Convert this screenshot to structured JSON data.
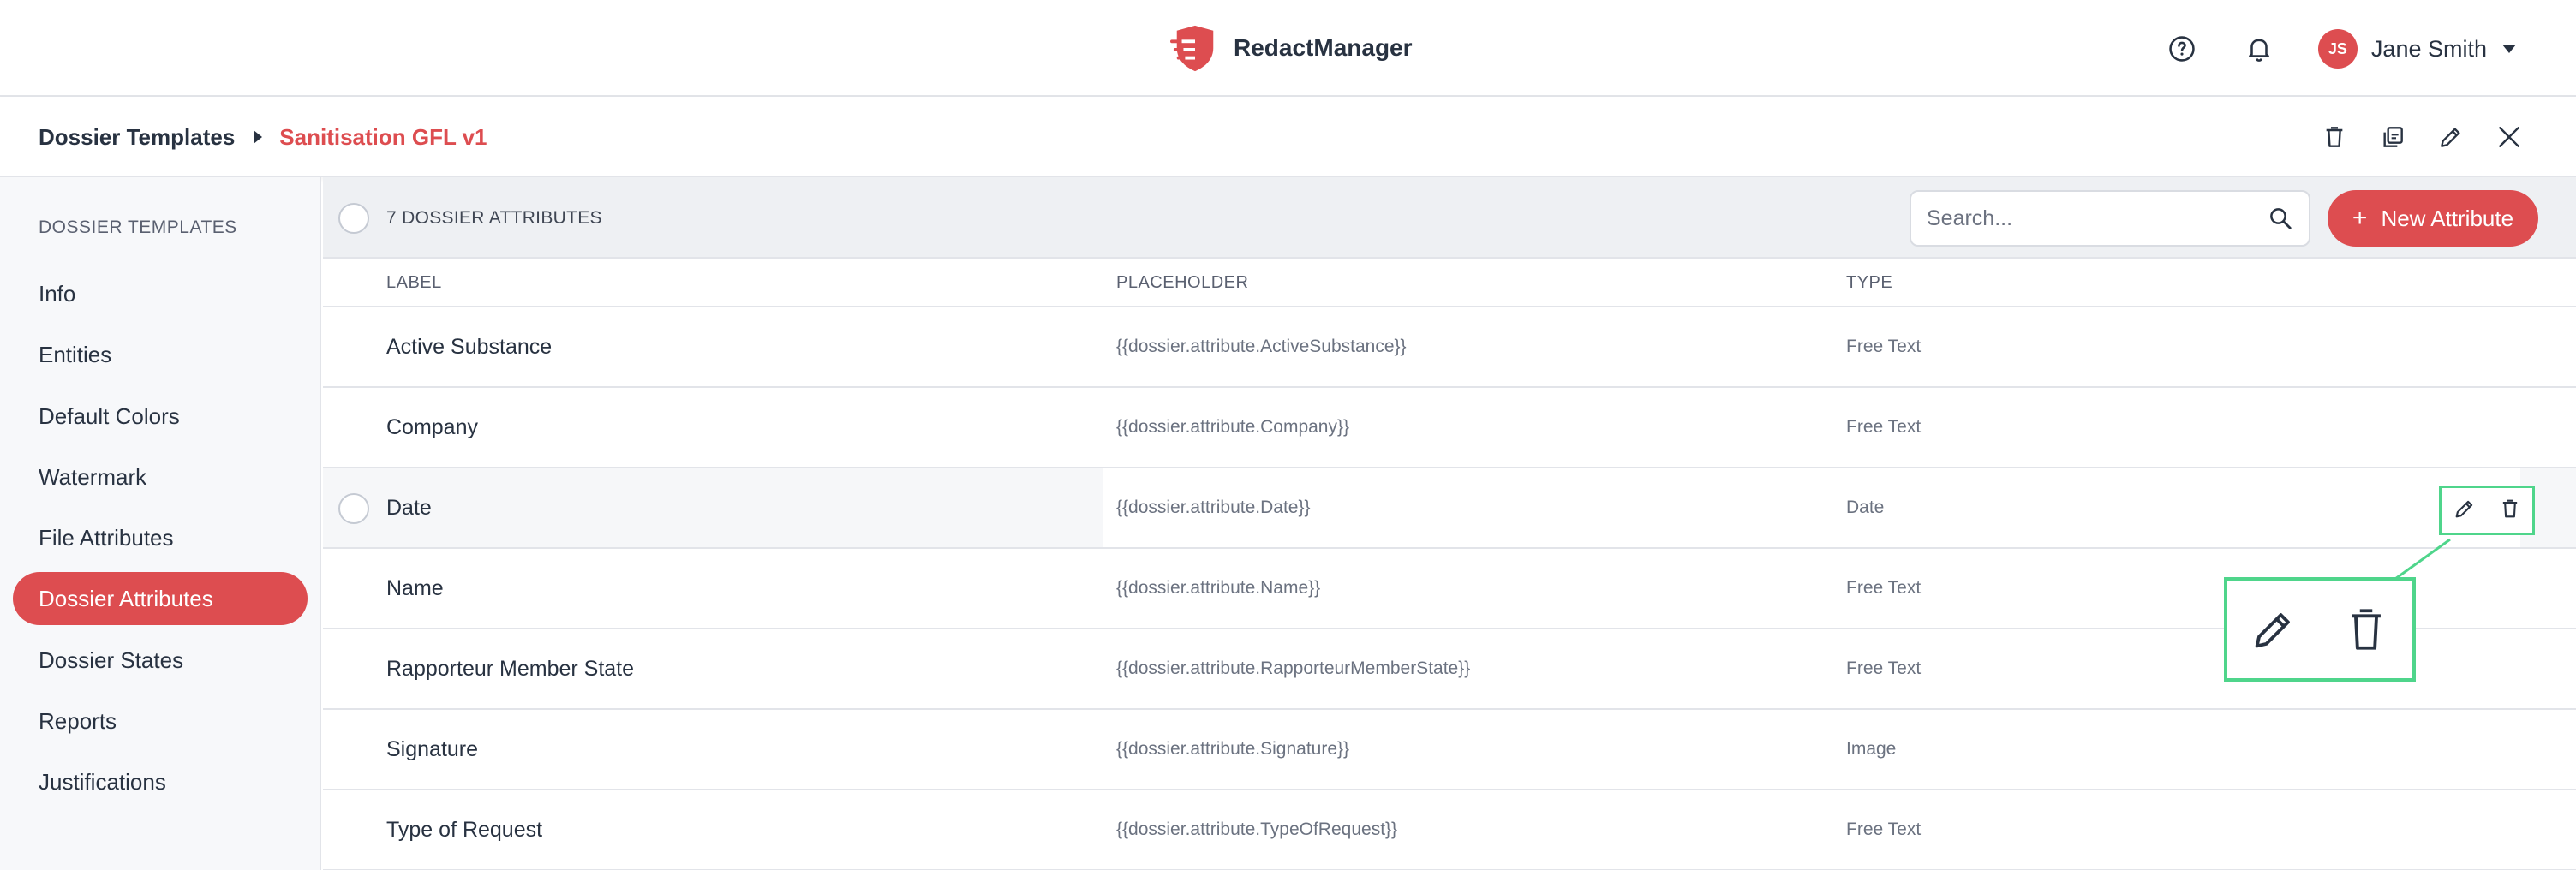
{
  "app": {
    "brand_name": "RedactManager",
    "brand_color": "#dd4d50"
  },
  "topbar": {
    "help_icon": "help-circle-icon",
    "notifications_icon": "bell-icon",
    "user": {
      "initials": "JS",
      "name": "Jane Smith"
    }
  },
  "breadcrumb": {
    "root": "Dossier Templates",
    "current": "Sanitisation GFL v1",
    "actions": [
      "trash-icon",
      "copy-icon",
      "pencil-icon",
      "close-icon"
    ]
  },
  "sidebar": {
    "heading": "DOSSIER TEMPLATES",
    "items": [
      {
        "label": "Info",
        "active": false
      },
      {
        "label": "Entities",
        "active": false
      },
      {
        "label": "Default Colors",
        "active": false
      },
      {
        "label": "Watermark",
        "active": false
      },
      {
        "label": "File Attributes",
        "active": false
      },
      {
        "label": "Dossier Attributes",
        "active": true
      },
      {
        "label": "Dossier States",
        "active": false
      },
      {
        "label": "Reports",
        "active": false
      },
      {
        "label": "Justifications",
        "active": false
      }
    ]
  },
  "toolbar": {
    "count_label": "7 DOSSIER ATTRIBUTES",
    "search_placeholder": "Search...",
    "search_value": "",
    "new_button_label": "New Attribute"
  },
  "table": {
    "columns": [
      "LABEL",
      "PLACEHOLDER",
      "TYPE"
    ],
    "rows": [
      {
        "label": "Active Substance",
        "placeholder": "{{dossier.attribute.ActiveSubstance}}",
        "type": "Free Text"
      },
      {
        "label": "Company",
        "placeholder": "{{dossier.attribute.Company}}",
        "type": "Free Text"
      },
      {
        "label": "Date",
        "placeholder": "{{dossier.attribute.Date}}",
        "type": "Date"
      },
      {
        "label": "Name",
        "placeholder": "{{dossier.attribute.Name}}",
        "type": "Free Text"
      },
      {
        "label": "Rapporteur Member State",
        "placeholder": "{{dossier.attribute.RapporteurMemberState}}",
        "type": "Free Text"
      },
      {
        "label": "Signature",
        "placeholder": "{{dossier.attribute.Signature}}",
        "type": "Image"
      },
      {
        "label": "Type of Request",
        "placeholder": "{{dossier.attribute.TypeOfRequest}}",
        "type": "Free Text"
      }
    ],
    "hovered_row": "Date",
    "row_action_icons": [
      "pencil-icon",
      "trash-icon"
    ]
  },
  "highlight_color": "#4fd58b"
}
